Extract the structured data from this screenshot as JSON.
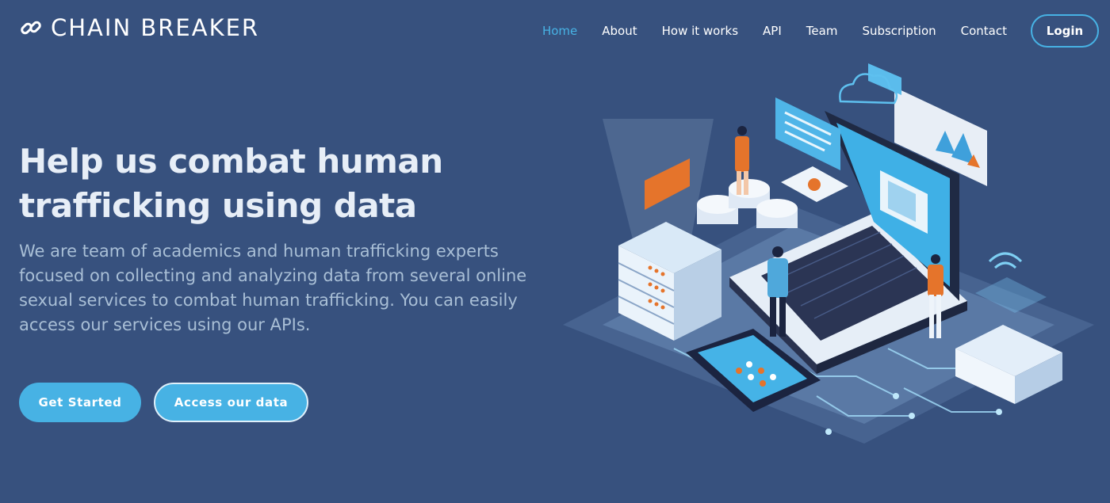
{
  "brand": {
    "name": "CHAIN BREAKER",
    "icon": "chain-link-icon"
  },
  "nav": {
    "items": [
      {
        "label": "Home",
        "active": true
      },
      {
        "label": "About",
        "active": false
      },
      {
        "label": "How it works",
        "active": false
      },
      {
        "label": "API",
        "active": false
      },
      {
        "label": "Team",
        "active": false
      },
      {
        "label": "Subscription",
        "active": false
      },
      {
        "label": "Contact",
        "active": false
      }
    ],
    "login_label": "Login"
  },
  "hero": {
    "title_line1": "Help us combat human",
    "title_line2": "trafficking using data",
    "description": "We are team of academics and human trafficking experts focused on collecting and analyzing data from several online sexual services to combat human trafficking. You can easily access our services using our APIs.",
    "get_started_label": "Get Started",
    "access_data_label": "Access our data"
  },
  "colors": {
    "background": "#37517e",
    "accent": "#47b2e4",
    "description_text": "#a9bfd6",
    "illustration_orange": "#e5742b"
  }
}
